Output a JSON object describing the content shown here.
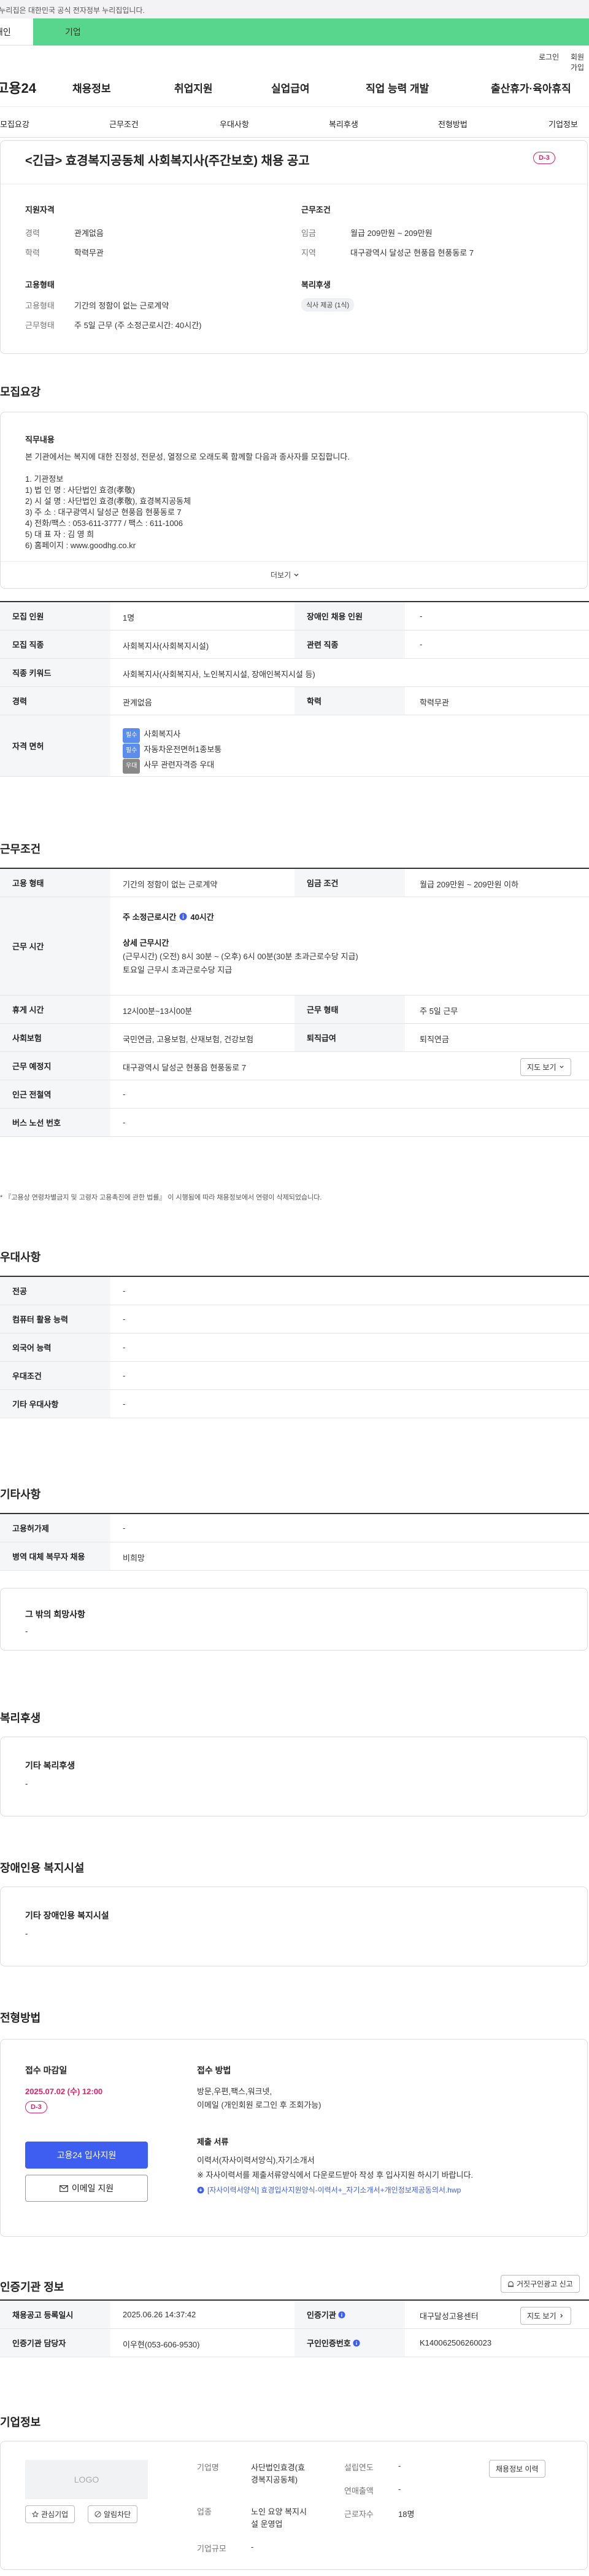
{
  "topbar": {
    "notice": "이 누리집은 대한민국 공식 전자정부 누리집입니다."
  },
  "usertabs": {
    "personal": "개인",
    "company": "기업"
  },
  "util": {
    "login": "로그인",
    "signup": "회원가입"
  },
  "gnb": {
    "logo": "고용24",
    "menu": [
      "채용정보",
      "취업지원",
      "실업급여",
      "직업 능력 개발",
      "출산휴가·육아휴직"
    ]
  },
  "snb": {
    "items": [
      "모집요강",
      "근무조건",
      "우대사항",
      "복리후생",
      "전형방법",
      "기업정보"
    ]
  },
  "job": {
    "title": "<긴급> 효경복지공동체 사회복지사(주간보호) 채용 공고",
    "dday": "D-3"
  },
  "summary": {
    "qual_title": "지원자격",
    "career_k": "경력",
    "career_v": "관계없음",
    "edu_k": "학력",
    "edu_v": "학력무관",
    "work_title": "근무조건",
    "wage_k": "임금",
    "wage_v": "월급 209만원 ~ 209만원",
    "loc_k": "지역",
    "loc_v": "대구광역시 달성군 현풍읍 현풍동로 7",
    "emp_title": "고용형태",
    "type_k": "고용형태",
    "type_v": "기간의 정함이 없는 근로계약",
    "hours_k": "근무형태",
    "hours_v": "주 5일 근무 (주 소정근로시간: 40시간)",
    "welfare_title": "복리후생",
    "welfare_chip": "식사 제공 (1식)"
  },
  "recruit": {
    "section_title": "모집요강",
    "duty_title": "직무내용",
    "duty_lines": [
      "본 기관에서는 복지에 대한 진정성, 전문성, 열정으로 오래도록 함께할 다음과 종사자를 모집합니다.",
      "",
      "1. 기관정보",
      "1) 법 인 명 : 사단법인 효경(孝敬)",
      "2) 시 설 명 : 사단법인 효경(孝敬), 효경복지공동체",
      "3) 주 소 : 대구광역시 달성군 현풍읍 현풍동로 7",
      "4) 전화/팩스 : 053-611-3777 / 팩스 : 611-1006",
      "5) 대 표 자 : 김 영 희",
      "6) 홈페이지 : www.goodhg.co.kr"
    ],
    "more": "더보기",
    "rows": {
      "count_k": "모집 인원",
      "count_v": "1명",
      "disabled_k": "장애인 채용 인원",
      "disabled_v": "-",
      "job_k": "모집 직종",
      "job_v": "사회복지사(사회복지시설)",
      "related_k": "관련 직종",
      "related_v": "-",
      "keyword_k": "직종 키워드",
      "keyword_v": "사회복지사(사회복지사, 노인복지시설, 장애인복지시설 등)",
      "career_k": "경력",
      "career_v": "관계없음",
      "edu_k": "학력",
      "edu_v": "학력무관",
      "license_k": "자격 면허",
      "licenses": [
        {
          "tag": "필수",
          "name": "사회복지사"
        },
        {
          "tag": "필수",
          "name": "자동차운전면허1종보통"
        },
        {
          "tag": "우대",
          "name": "사무 관련자격증 우대"
        }
      ]
    }
  },
  "conditions": {
    "section_title": "근무조건",
    "type_k": "고용 형태",
    "type_v": "기간의 정함이 없는 근로계약",
    "wage_k": "임금 조건",
    "wage_v": "월급 209만원 ~ 209만원 이하",
    "time_k": "근무 시간",
    "weekly": "주 소정근로시간",
    "weekly_v": "40시간",
    "detail_title": "상세 근무시간",
    "detail_1": "(근무시간) (오전) 8시 30분 ~ (오후) 6시 00분(30분 초과근로수당 지급)",
    "detail_2": "토요일 근무시 초과근로수당 지급",
    "break_k": "휴게 시간",
    "break_v": "12시00분~13시00분",
    "form_k": "근무 형태",
    "form_v": "주 5일 근무",
    "insurance_k": "사회보험",
    "insurance_v": "국민연금, 고용보험, 산재보험, 건강보험",
    "severance_k": "퇴직급여",
    "severance_v": "퇴직연금",
    "place_k": "근무 예정지",
    "place_v": "대구광역시 달성군 현풍읍 현풍동로 7",
    "map_btn": "지도 보기",
    "subway_k": "인근 전철역",
    "subway_v": "-",
    "bus_k": "버스 노선 번호",
    "bus_v": "-",
    "note": "* 『고용상 연령차별금지 및 고령자 고용촉진에 관한 법률』 이 시행됨에 따라 채용정보에서 연령이 삭제되었습니다."
  },
  "preference": {
    "section_title": "우대사항",
    "rows": [
      {
        "k": "전공",
        "v": "-"
      },
      {
        "k": "컴퓨터 활용 능력",
        "v": "-"
      },
      {
        "k": "외국어 능력",
        "v": "-"
      },
      {
        "k": "우대조건",
        "v": "-"
      },
      {
        "k": "기타 우대사항",
        "v": "-"
      }
    ]
  },
  "etc": {
    "section_title": "기타사항",
    "rows": [
      {
        "k": "고용허가제",
        "v": "-"
      },
      {
        "k": "병역 대체 복무자 채용",
        "v": "비희망"
      }
    ],
    "other_title": "그 밖의 희망사항",
    "other_v": "-"
  },
  "welfare": {
    "section_title": "복리후생",
    "box_title": "기타 복리후생",
    "box_v": "-"
  },
  "disabled": {
    "section_title": "장애인용 복지시설",
    "box_title": "기타 장애인용 복지시설",
    "box_v": "-"
  },
  "selection": {
    "section_title": "전형방법",
    "deadline_title": "접수 마감일",
    "deadline_v": "2025.07.02 (수) 12:00",
    "dday": "D-3",
    "apply_btn": "고용24 입사지원",
    "email_btn": "이메일 지원",
    "method_title": "접수 방법",
    "method_v1": "방문,우편,팩스,워크넷,",
    "method_v2": "이메일 (개인회원 로그인 후 조회가능)",
    "docs_title": "제출 서류",
    "docs_v1": "이력서(자사이력서양식),자기소개서",
    "docs_v2": "※ 자사이력서를 제출서류양식에서 다운로드받아 작성 후 입사지원 하시기 바랍니다.",
    "doc_link": "[자사이력서양식] 효경입사지원양식-이력서+_자기소개서+개인정보제공동의서.hwp"
  },
  "cert": {
    "section_title": "인증기관 정보",
    "report_btn": "거짓구인광고 신고",
    "reg_k": "채용공고 등록일시",
    "reg_v": "2025.06.26 14:37:42",
    "org_k": "인증기관",
    "org_v": "대구달성고용센터",
    "map_btn": "지도 보기",
    "contact_k": "인증기관 담당자",
    "contact_v": "이우현(053-606-9530)",
    "no_k": "구인인증번호",
    "no_v": "K140062506260023"
  },
  "company": {
    "section_title": "기업정보",
    "logo": "LOGO",
    "interest_btn": "관심기업",
    "follow_btn": "알림차단",
    "name_k": "기업명",
    "name_v1": "사단법인효경(효",
    "name_v2": "경복지공동체)",
    "year_k": "설립연도",
    "year_v": "-",
    "sales_k": "연매출액",
    "sales_v": "-",
    "biz_k": "업종",
    "biz_v1": "노인 요양 복지시",
    "biz_v2": "설 운영업",
    "emp_k": "근로자수",
    "emp_v": "18명",
    "size_k": "기업규모",
    "size_v": "-",
    "jobs_btn": "채용정보 이력"
  },
  "colors": {
    "accent": "#3d5ef0",
    "dday": "#e0206a",
    "company_tab": "#58d68d"
  }
}
